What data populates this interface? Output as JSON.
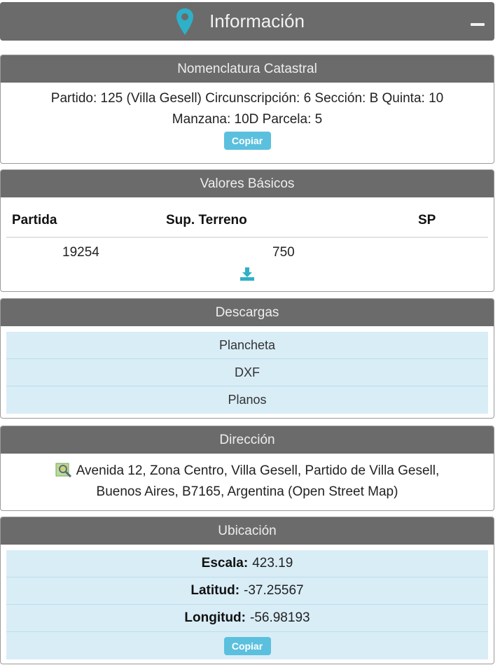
{
  "header": {
    "title": "Información",
    "collapse_icon": "minus-icon",
    "location_icon": "map-pin-icon",
    "accent": "#2eb0c8"
  },
  "nomenclatura": {
    "title": "Nomenclatura Catastral",
    "line1": "Partido: 125 (Villa Gesell) Circunscripción: 6 Sección: B Quinta: 10",
    "line2": "Manzana: 10D Parcela: 5",
    "copy_label": "Copiar"
  },
  "valores": {
    "title": "Valores Básicos",
    "columns": [
      "Partida",
      "Sup. Terreno",
      "SP"
    ],
    "row": [
      "19254",
      "750",
      ""
    ],
    "download_icon": "download-icon"
  },
  "descargas": {
    "title": "Descargas",
    "items": [
      "Plancheta",
      "DXF",
      "Planos"
    ]
  },
  "direccion": {
    "title": "Dirección",
    "line1": "Avenida 12, Zona Centro, Villa Gesell, Partido de Villa Gesell,",
    "line2": "Buenos Aires, B7165, Argentina (Open Street Map)",
    "map_icon": "map-search-icon"
  },
  "ubicacion": {
    "title": "Ubicación",
    "escala_label": "Escala:",
    "escala_value": "423.19",
    "latitud_label": "Latitud:",
    "latitud_value": "-37.25567",
    "longitud_label": "Longitud:",
    "longitud_value": "-56.98193",
    "copy_label": "Copiar"
  },
  "colors": {
    "header_bg": "#6b6b6b",
    "row_bg": "#d9edf7",
    "button_bg": "#5bc0de"
  }
}
